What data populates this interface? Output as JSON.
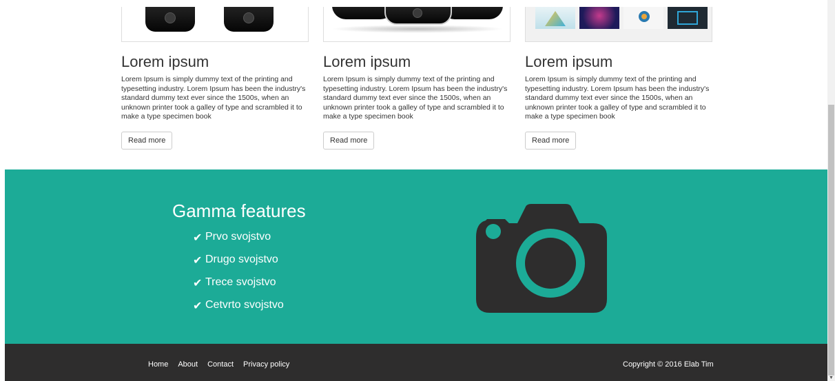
{
  "cards": [
    {
      "title": "Lorem ipsum",
      "body": "Lorem Ipsum is simply dummy text of the printing and typesetting industry. Lorem Ipsum has been the industry's standard dummy text ever since the 1500s, when an unknown printer took a galley of type and scrambled it to make a type specimen book",
      "button_label": "Read more"
    },
    {
      "title": "Lorem ipsum",
      "body": "Lorem Ipsum is simply dummy text of the printing and typesetting industry. Lorem Ipsum has been the industry's standard dummy text ever since the 1500s, when an unknown printer took a galley of type and scrambled it to make a type specimen book",
      "button_label": "Read more"
    },
    {
      "title": "Lorem ipsum",
      "body": "Lorem Ipsum is simply dummy text of the printing and typesetting industry. Lorem Ipsum has been the industry's standard dummy text ever since the 1500s, when an unknown printer took a galley of type and scrambled it to make a type specimen book",
      "button_label": "Read more"
    }
  ],
  "features": {
    "title": "Gamma features",
    "items": [
      "Prvo svojstvo",
      "Drugo svojstvo",
      "Trece svojstvo",
      "Cetvrto svojstvo"
    ],
    "check_glyph": "✔",
    "icon": "camera-icon"
  },
  "footer": {
    "links": [
      "Home",
      "About",
      "Contact",
      "Privacy policy"
    ],
    "copyright": "Copyright © 2016 Elab Tim"
  },
  "colors": {
    "accent": "#1cab97",
    "footer_bg": "#2e2d2d",
    "camera": "#2e2d2d"
  }
}
